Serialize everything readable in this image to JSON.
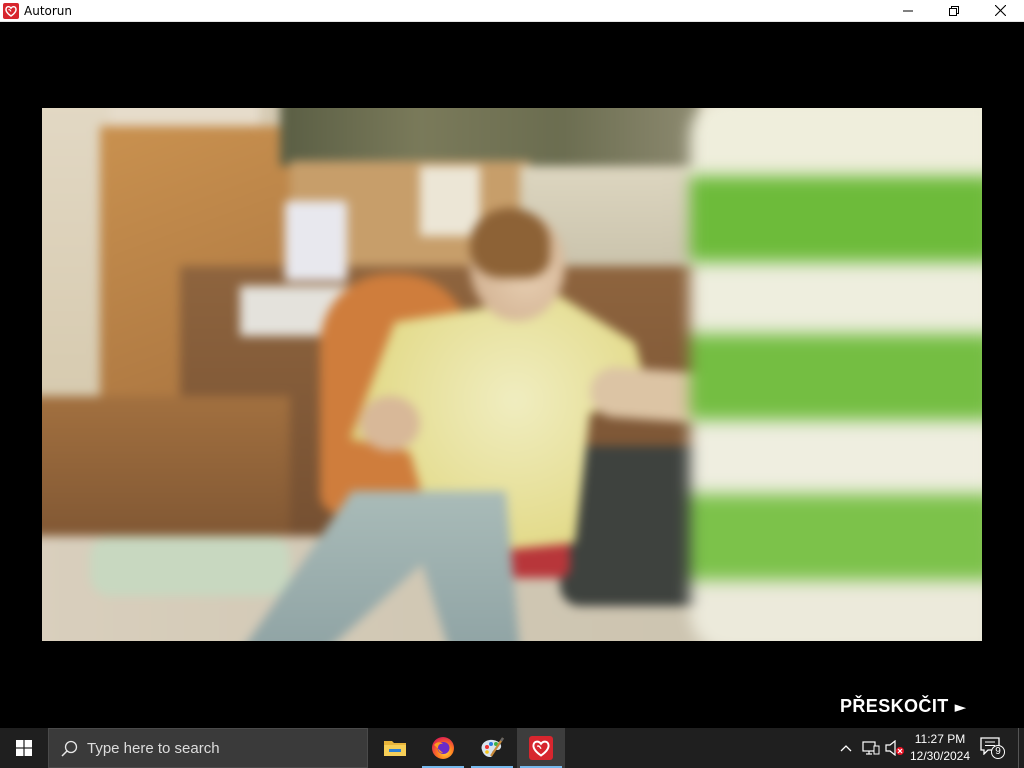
{
  "window": {
    "title": "Autorun",
    "icon": "heart-brand-icon",
    "controls": [
      "minimize-icon",
      "restore-icon",
      "close-icon"
    ]
  },
  "player": {
    "skip_label": "PŘESKOČIT",
    "skip_arrow": "►"
  },
  "taskbar": {
    "start_icon": "windows-logo-icon",
    "search_icon": "search-icon",
    "search_placeholder": "Type here to search",
    "apps": [
      {
        "icon": "file-explorer-icon",
        "running": false,
        "active": false
      },
      {
        "icon": "firefox-icon",
        "running": true,
        "active": false
      },
      {
        "icon": "paint-icon",
        "running": true,
        "active": false
      },
      {
        "icon": "heart-brand-icon",
        "running": true,
        "active": true
      }
    ],
    "tray": {
      "icons": [
        "chevron-up-icon",
        "network-icon",
        "volume-muted-icon"
      ],
      "time": "11:27 PM",
      "date": "12/30/2024",
      "notification_icon": "notification-icon",
      "notification_count": "9"
    }
  },
  "colors": {
    "title_bar_bg": "#ffffff",
    "player_bg": "#000000",
    "taskbar_bg": "#1f1f1f",
    "brand_red": "#d7262e",
    "running_indicator": "#76b9ed"
  }
}
